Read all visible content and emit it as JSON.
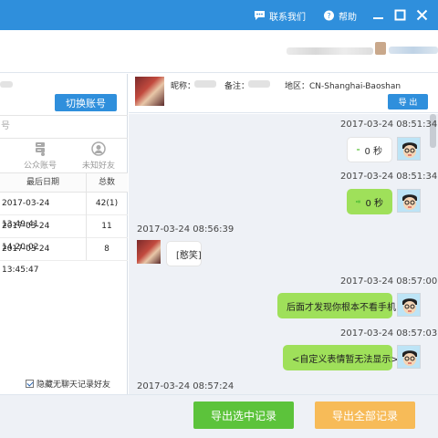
{
  "titlebar": {
    "contact_us": "联系我们",
    "help": "帮助"
  },
  "account": {
    "switch_label": "切换账号"
  },
  "left": {
    "search_placeholder": "号",
    "categories": {
      "public": "公众账号",
      "unknown": "未知好友"
    },
    "headers": {
      "last_date": "最后日期",
      "count": "总数"
    },
    "rows": [
      {
        "date": "2017-03-24 13:49:41",
        "count": "42(1)"
      },
      {
        "date": "2017-03-24 14:20:02",
        "count": "11"
      },
      {
        "date": "2017-03-24 13:45:47",
        "count": "8"
      }
    ],
    "hide_empty": "隐藏无聊天记录好友"
  },
  "contact": {
    "nickname_label": "昵称：",
    "note_label": "备注：",
    "region": "地区：CN-Shanghai-Baoshan",
    "export": "导 出"
  },
  "messages": {
    "m1": {
      "time": "2017-03-24 08:51:34",
      "text": "0 秒"
    },
    "m2": {
      "time": "2017-03-24 08:51:34",
      "text": "0 秒"
    },
    "m3": {
      "time": "2017-03-24 08:56:39",
      "text": "[憨笑]"
    },
    "m4": {
      "time": "2017-03-24 08:57:00",
      "text": "后面才发现你根本不看手机"
    },
    "m5": {
      "time": "2017-03-24 08:57:03",
      "text": "<自定义表情暂无法显示>"
    },
    "m6": {
      "time": "2017-03-24 08:57:24"
    }
  },
  "footer": {
    "export_selected": "导出选中记录",
    "export_all": "导出全部记录"
  },
  "colors": {
    "brand": "#2f8fdc",
    "bubble_green": "#9fe05a",
    "btn_green": "#5cc33b",
    "btn_orange": "#f7bb58"
  }
}
